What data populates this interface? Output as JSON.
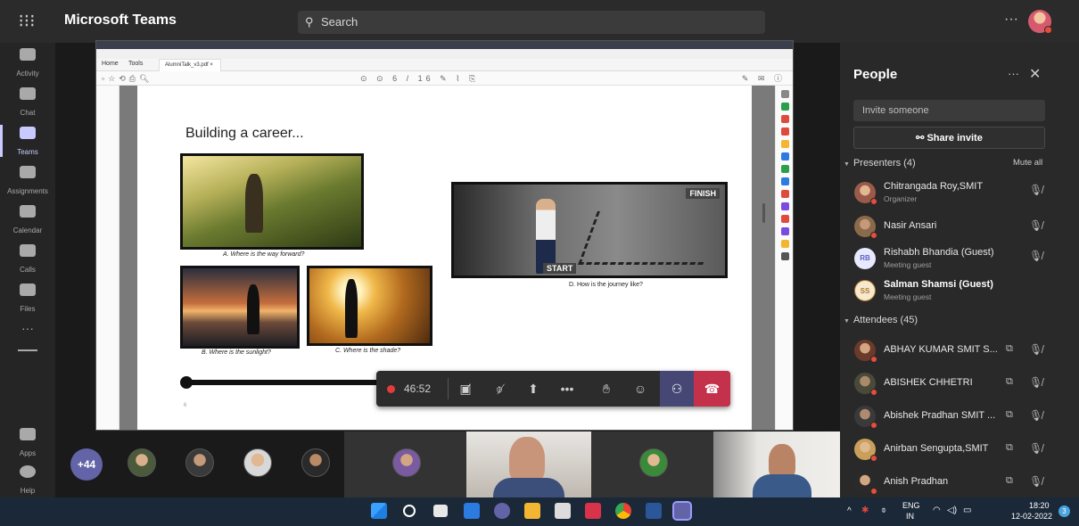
{
  "app": {
    "title": "Microsoft Teams",
    "more": "···"
  },
  "search": {
    "placeholder": "Search",
    "icon": "search-icon"
  },
  "rail": {
    "items": [
      {
        "label": "Activity",
        "icon": "bell-icon"
      },
      {
        "label": "Chat",
        "icon": "chat-icon"
      },
      {
        "label": "Teams",
        "icon": "teams-icon"
      },
      {
        "label": "Assignments",
        "icon": "assignments-icon"
      },
      {
        "label": "Calendar",
        "icon": "calendar-icon"
      },
      {
        "label": "Calls",
        "icon": "phone-icon"
      },
      {
        "label": "Files",
        "icon": "file-icon"
      },
      {
        "label": "Apps",
        "icon": "apps-icon"
      },
      {
        "label": "Help",
        "icon": "help-icon"
      }
    ],
    "more": "···"
  },
  "shared": {
    "tabs": {
      "home": "Home",
      "tools": "Tools",
      "file": "AlumniTalk_v3.pdf  ×"
    },
    "page_indicator": "6 / 16",
    "slide": {
      "title": "Building a career...",
      "captions": {
        "a": "A. Where is the way forward?",
        "b": "B. Where is the sunlight?",
        "c": "C. Where is the shade?",
        "d": "D. How is the journey like?"
      },
      "sign_finish": "FINISH",
      "sign_start": "START",
      "page_number": "6"
    }
  },
  "controls": {
    "timer": "46:52",
    "icons": [
      "camera-off-icon",
      "mic-off-icon",
      "share-screen-icon",
      "more-icon",
      "raise-hand-icon",
      "chat-icon",
      "people-icon",
      "hang-up-icon"
    ]
  },
  "strip": {
    "overflow": "+44"
  },
  "people": {
    "title": "People",
    "invite_placeholder": "Invite someone",
    "share_invite": "Share invite",
    "presenters_header": "Presenters (4)",
    "mute_all": "Mute all",
    "attendees_header": "Attendees (45)",
    "presenters": [
      {
        "name": "Chitrangada Roy,SMIT",
        "role": "Organizer"
      },
      {
        "name": "Nasir Ansari",
        "role": ""
      },
      {
        "name": "Rishabh Bhandia (Guest)",
        "role": "Meeting guest",
        "initials": "RB"
      },
      {
        "name": "Salman Shamsi (Guest)",
        "role": "Meeting guest",
        "initials": "SS"
      }
    ],
    "attendees": [
      {
        "name": "ABHAY KUMAR SMIT S..."
      },
      {
        "name": "ABISHEK CHHETRI"
      },
      {
        "name": "Abishek Pradhan SMIT ..."
      },
      {
        "name": "Anirban Sengupta,SMIT"
      },
      {
        "name": "Anish Pradhan"
      }
    ]
  },
  "taskbar": {
    "lang_top": "ENG",
    "lang_bottom": "IN",
    "time": "18:20",
    "date": "12-02-2022",
    "notifications": "3"
  },
  "colors": {
    "accent": "#6264a7",
    "hangup": "#c4314b",
    "status_busy": "#e74c3c"
  }
}
